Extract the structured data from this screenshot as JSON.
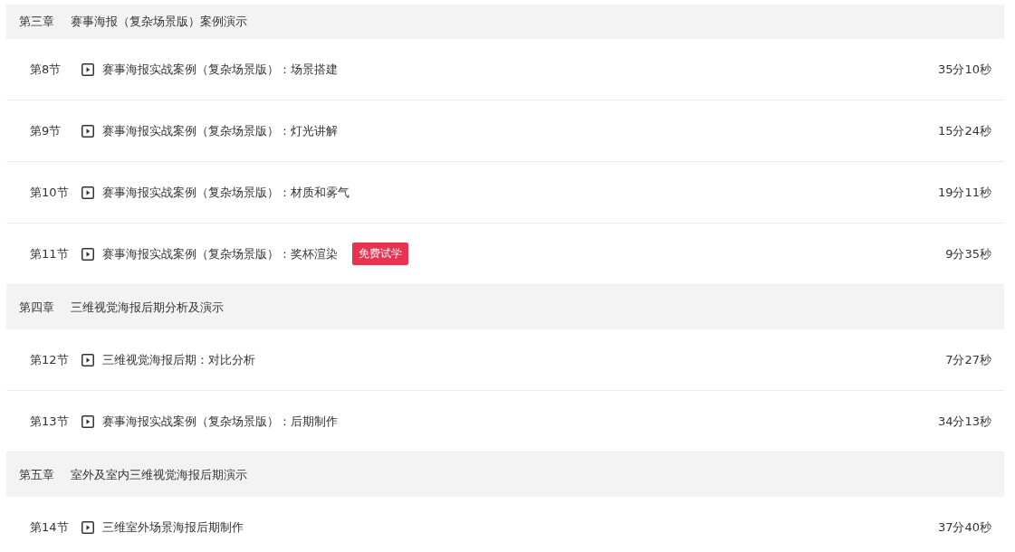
{
  "chapters": [
    {
      "number": "第三章",
      "title": "赛事海报（复杂场景版）案例演示",
      "lessons": [
        {
          "number": "第8节",
          "title": "赛事海报实战案例（复杂场景版）：场景搭建",
          "duration": "35分10秒"
        },
        {
          "number": "第9节",
          "title": "赛事海报实战案例（复杂场景版）：灯光讲解",
          "duration": "15分24秒"
        },
        {
          "number": "第10节",
          "title": "赛事海报实战案例（复杂场景版）：材质和雾气",
          "duration": "19分11秒"
        },
        {
          "number": "第11节",
          "title": "赛事海报实战案例（复杂场景版）：奖杯渲染",
          "duration": "9分35秒",
          "badge": "免费试学"
        }
      ]
    },
    {
      "number": "第四章",
      "title": "三维视觉海报后期分析及演示",
      "lessons": [
        {
          "number": "第12节",
          "title": "三维视觉海报后期：对比分析",
          "duration": "7分27秒"
        },
        {
          "number": "第13节",
          "title": "赛事海报实战案例（复杂场景版）：后期制作",
          "duration": "34分13秒"
        }
      ]
    },
    {
      "number": "第五章",
      "title": "室外及室内三维视觉海报后期演示",
      "lessons": [
        {
          "number": "第14节",
          "title": "三维室外场景海报后期制作",
          "duration": "37分40秒"
        }
      ]
    }
  ]
}
